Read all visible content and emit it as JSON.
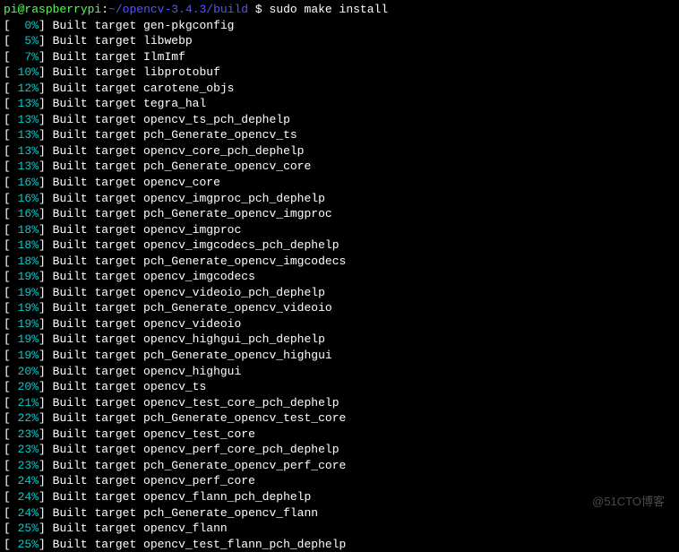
{
  "prompt": {
    "user": "pi",
    "at": "@",
    "host": "raspberrypi",
    "colon": ":",
    "tilde": "~",
    "path": "/opencv-3.4.3/build",
    "dollar": " $ ",
    "command": "sudo make install"
  },
  "build_lines": [
    {
      "pct": "  0%",
      "text": "Built target gen-pkgconfig"
    },
    {
      "pct": "  5%",
      "text": "Built target libwebp"
    },
    {
      "pct": "  7%",
      "text": "Built target IlmImf"
    },
    {
      "pct": " 10%",
      "text": "Built target libprotobuf"
    },
    {
      "pct": " 12%",
      "text": "Built target carotene_objs"
    },
    {
      "pct": " 13%",
      "text": "Built target tegra_hal"
    },
    {
      "pct": " 13%",
      "text": "Built target opencv_ts_pch_dephelp"
    },
    {
      "pct": " 13%",
      "text": "Built target pch_Generate_opencv_ts"
    },
    {
      "pct": " 13%",
      "text": "Built target opencv_core_pch_dephelp"
    },
    {
      "pct": " 13%",
      "text": "Built target pch_Generate_opencv_core"
    },
    {
      "pct": " 16%",
      "text": "Built target opencv_core"
    },
    {
      "pct": " 16%",
      "text": "Built target opencv_imgproc_pch_dephelp"
    },
    {
      "pct": " 16%",
      "text": "Built target pch_Generate_opencv_imgproc"
    },
    {
      "pct": " 18%",
      "text": "Built target opencv_imgproc"
    },
    {
      "pct": " 18%",
      "text": "Built target opencv_imgcodecs_pch_dephelp"
    },
    {
      "pct": " 18%",
      "text": "Built target pch_Generate_opencv_imgcodecs"
    },
    {
      "pct": " 19%",
      "text": "Built target opencv_imgcodecs"
    },
    {
      "pct": " 19%",
      "text": "Built target opencv_videoio_pch_dephelp"
    },
    {
      "pct": " 19%",
      "text": "Built target pch_Generate_opencv_videoio"
    },
    {
      "pct": " 19%",
      "text": "Built target opencv_videoio"
    },
    {
      "pct": " 19%",
      "text": "Built target opencv_highgui_pch_dephelp"
    },
    {
      "pct": " 19%",
      "text": "Built target pch_Generate_opencv_highgui"
    },
    {
      "pct": " 20%",
      "text": "Built target opencv_highgui"
    },
    {
      "pct": " 20%",
      "text": "Built target opencv_ts"
    },
    {
      "pct": " 21%",
      "text": "Built target opencv_test_core_pch_dephelp"
    },
    {
      "pct": " 22%",
      "text": "Built target pch_Generate_opencv_test_core"
    },
    {
      "pct": " 23%",
      "text": "Built target opencv_test_core"
    },
    {
      "pct": " 23%",
      "text": "Built target opencv_perf_core_pch_dephelp"
    },
    {
      "pct": " 23%",
      "text": "Built target pch_Generate_opencv_perf_core"
    },
    {
      "pct": " 24%",
      "text": "Built target opencv_perf_core"
    },
    {
      "pct": " 24%",
      "text": "Built target opencv_flann_pch_dephelp"
    },
    {
      "pct": " 24%",
      "text": "Built target pch_Generate_opencv_flann"
    },
    {
      "pct": " 25%",
      "text": "Built target opencv_flann"
    },
    {
      "pct": " 25%",
      "text": "Built target opencv_test_flann_pch_dephelp"
    }
  ],
  "watermark": "@51CTO博客"
}
